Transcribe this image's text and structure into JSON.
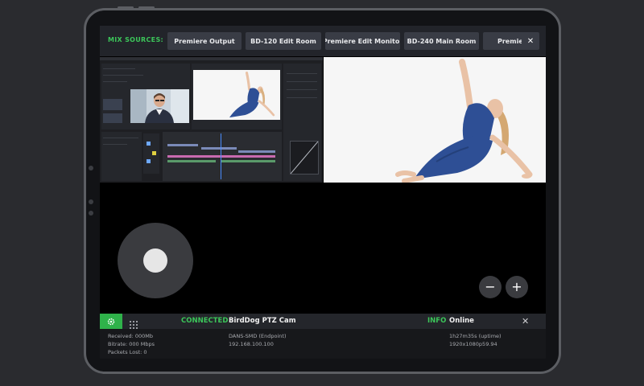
{
  "mix_sources": {
    "label": "MIX SOURCES:",
    "sources": [
      "Premiere Output",
      "BD-120 Edit Room",
      "Premiere Edit Monitor",
      "BD-240 Main Room",
      "Premie"
    ],
    "close_glyph": "✕"
  },
  "preview": {
    "left_pane": "premiere-editor-screen",
    "right_pane": "dancer-video-feed"
  },
  "ptz": {
    "zoom_out_glyph": "−",
    "zoom_in_glyph": "+"
  },
  "status": {
    "connection_label": "CONNECTED",
    "camera_name": "BirdDog PTZ Cam",
    "info_label": "INFO",
    "info_value": "Online",
    "close_glyph": "✕",
    "received": "Received: 000Mb",
    "bitrate": "Bitrate: 000 Mbps",
    "packets_lost": "Packets Lost: 0",
    "device": "DANS-SMD (Endpoint)",
    "ip": "192.168.100.100",
    "uptime": "1h27m35s (uptime)",
    "resolution": "1920x1080p59.94"
  },
  "colors": {
    "accent_green": "#3cc65a",
    "button_green": "#2fb24a",
    "button_bg": "#393c45",
    "dress_blue": "#2e4f95"
  },
  "icons": [
    "gear-icon",
    "grid-icon",
    "close-icon",
    "minus-icon",
    "plus-icon"
  ]
}
